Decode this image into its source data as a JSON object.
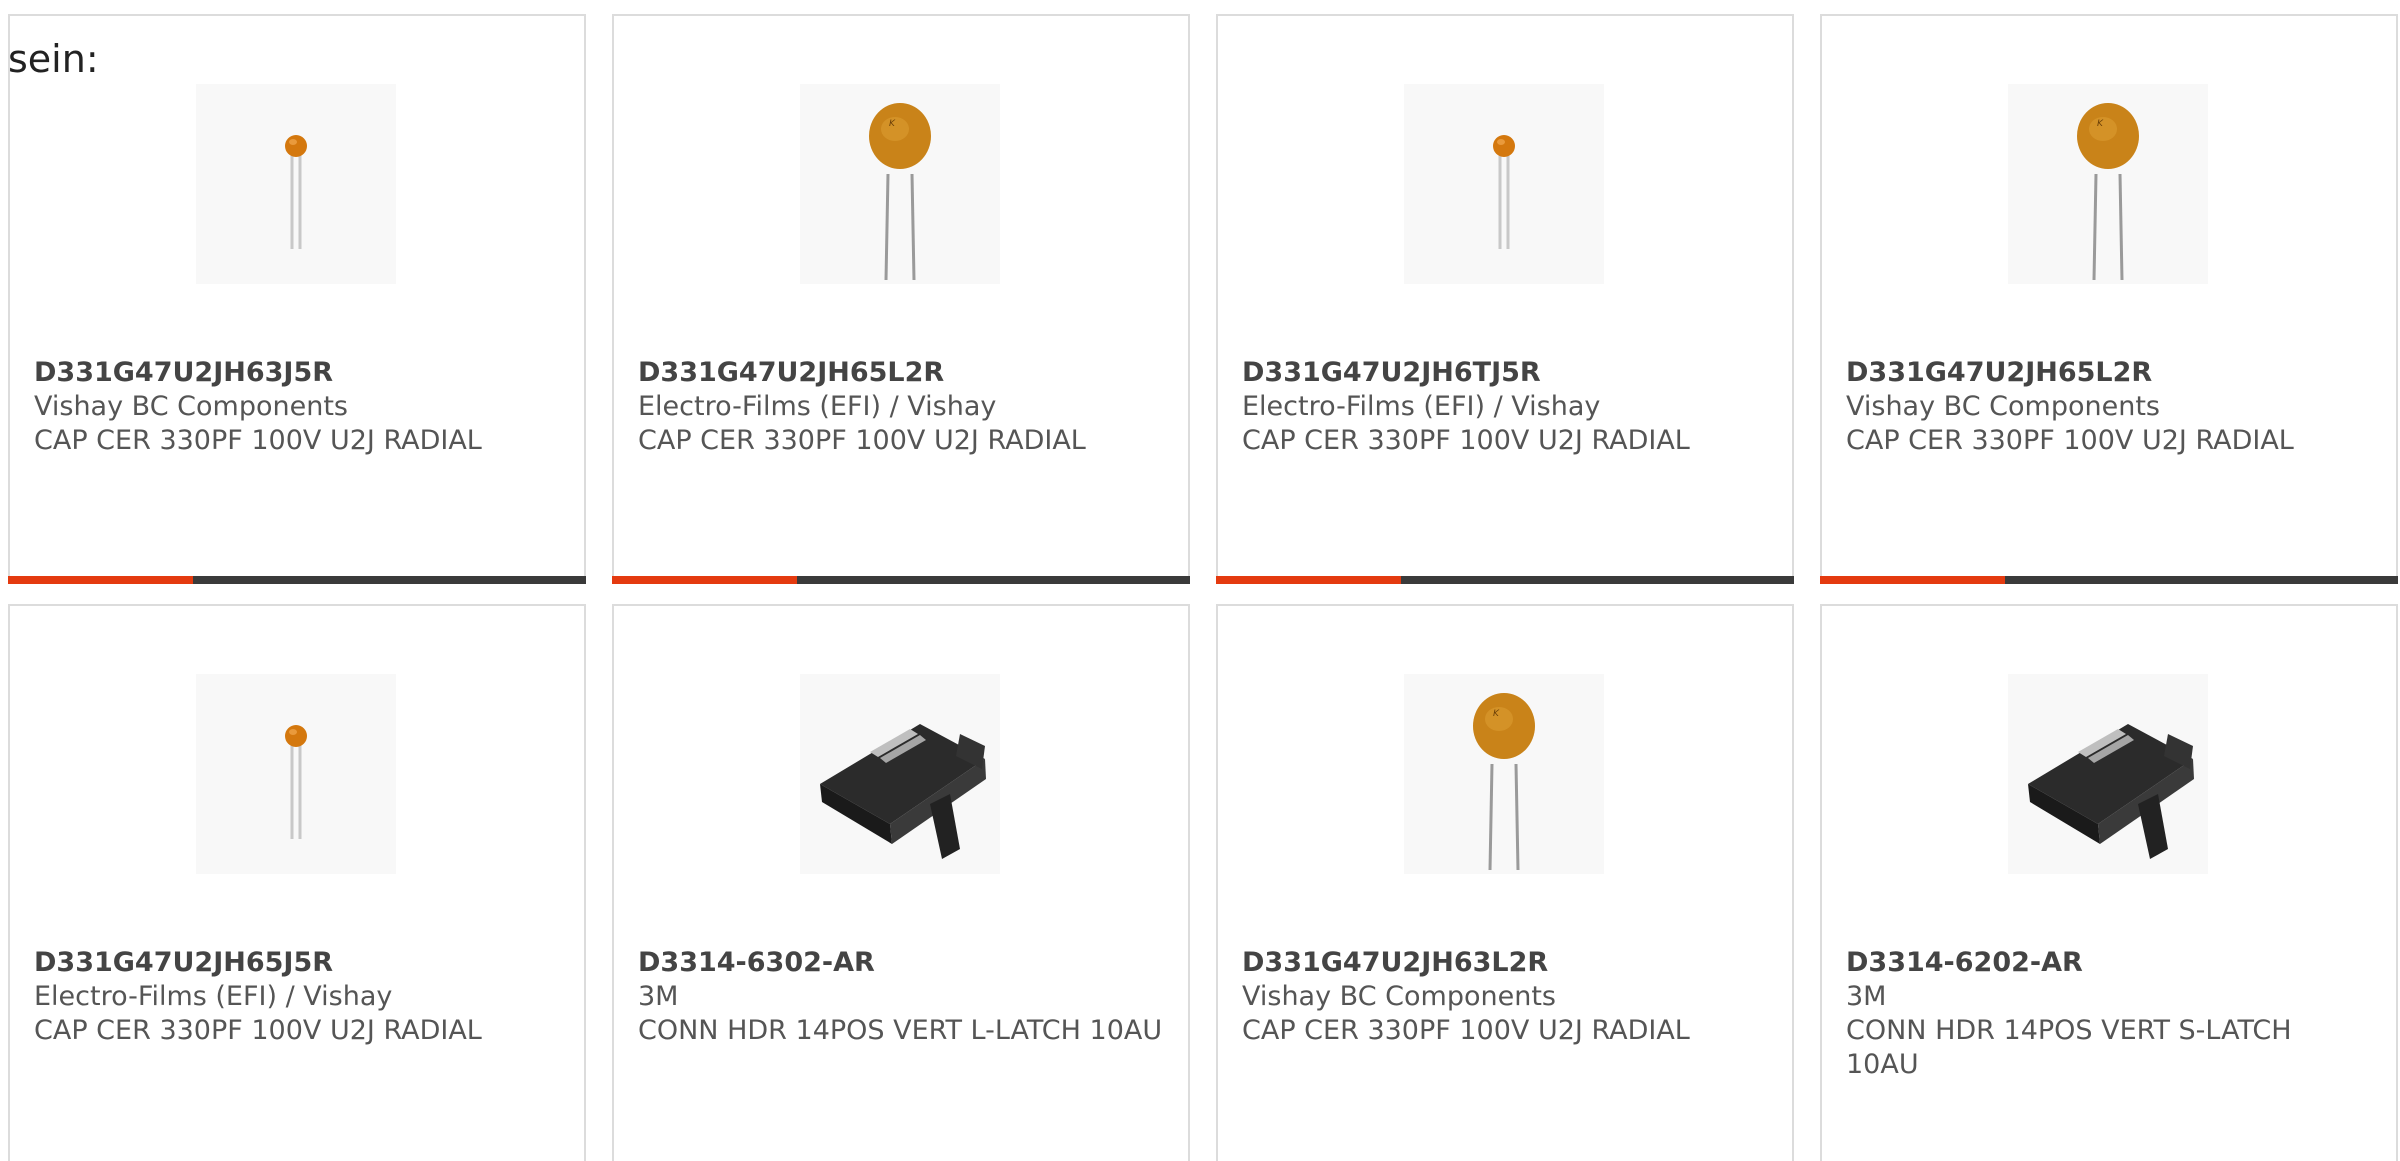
{
  "heading": "sein:",
  "accent_color": "#e43a0f",
  "bar_color": "#3a3a3a",
  "products": [
    {
      "part_number": "D331G47U2JH63J5R",
      "manufacturer": "Vishay BC Components",
      "description": "CAP CER 330PF 100V U2J RADIAL",
      "image": "ceramic-capacitor-small",
      "progress": 0.32
    },
    {
      "part_number": "D331G47U2JH65L2R",
      "manufacturer": "Electro-Films (EFI) / Vishay",
      "description": "CAP CER 330PF 100V U2J RADIAL",
      "image": "ceramic-capacitor-large",
      "progress": 0.32
    },
    {
      "part_number": "D331G47U2JH6TJ5R",
      "manufacturer": "Electro-Films (EFI) / Vishay",
      "description": "CAP CER 330PF 100V U2J RADIAL",
      "image": "ceramic-capacitor-small",
      "progress": 0.32
    },
    {
      "part_number": "D331G47U2JH65L2R",
      "manufacturer": "Vishay BC Components",
      "description": "CAP CER 330PF 100V U2J RADIAL",
      "image": "ceramic-capacitor-large",
      "progress": 0.32
    },
    {
      "part_number": "D331G47U2JH65J5R",
      "manufacturer": "Electro-Films (EFI) / Vishay",
      "description": "CAP CER 330PF 100V U2J RADIAL",
      "image": "ceramic-capacitor-small"
    },
    {
      "part_number": "D3314-6302-AR",
      "manufacturer": "3M",
      "description": "CONN HDR 14POS VERT L-LATCH 10AU",
      "image": "header-connector"
    },
    {
      "part_number": "D331G47U2JH63L2R",
      "manufacturer": "Vishay BC Components",
      "description": "CAP CER 330PF 100V U2J RADIAL",
      "image": "ceramic-capacitor-large"
    },
    {
      "part_number": "D3314-6202-AR",
      "manufacturer": "3M",
      "description": "CONN HDR 14POS VERT S-LATCH 10AU",
      "image": "header-connector"
    }
  ]
}
